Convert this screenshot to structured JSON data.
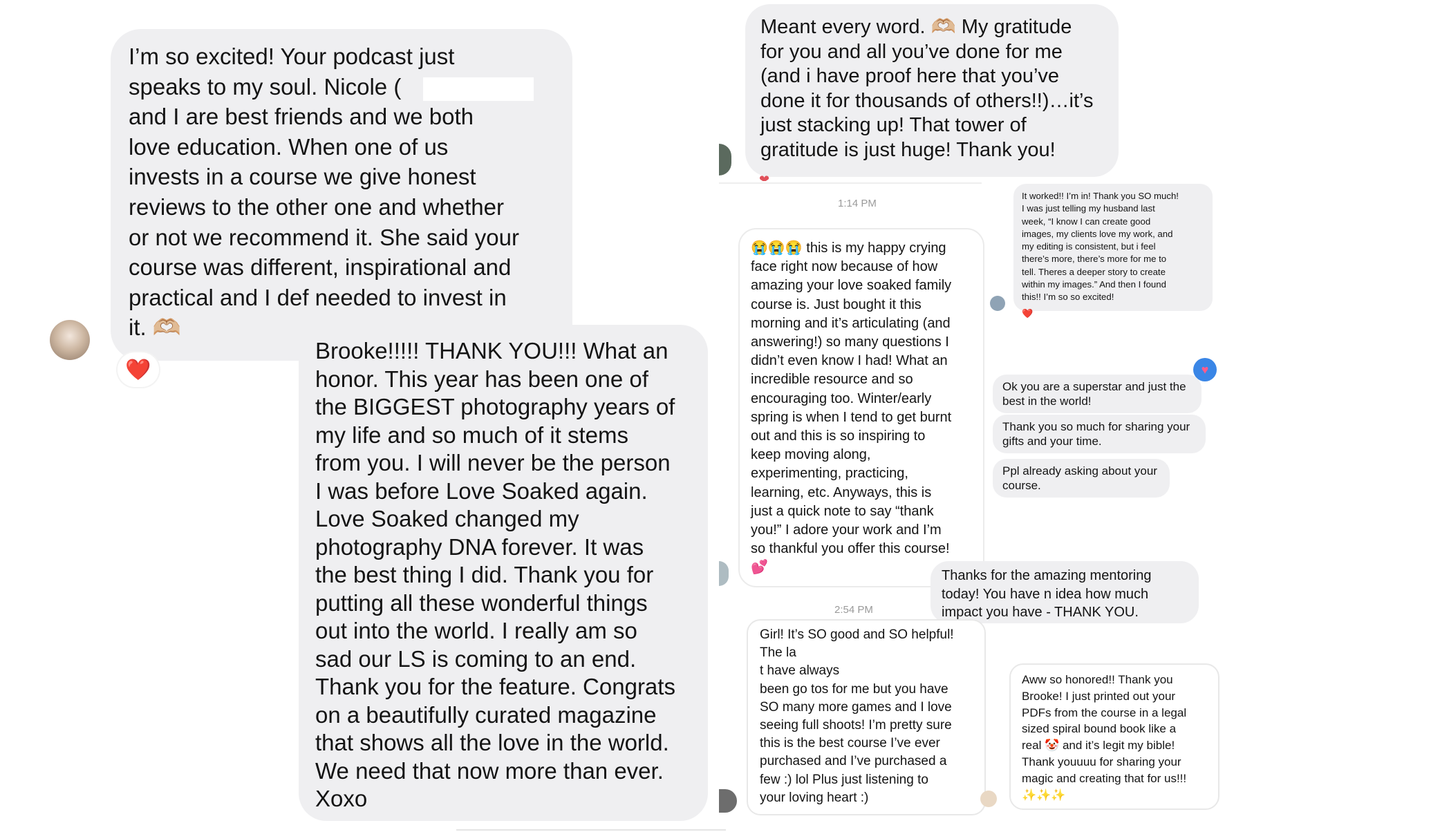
{
  "left": {
    "bubble1": "I’m so excited! Your podcast just\nspeaks to my soul. Nicole (\nand I are best friends and we both\nlove education. When one of us\ninvests in a course we give honest\nreviews to the other one and whether\nor not we recommend it. She said your\ncourse was different, inspirational and\npractical and I def needed to invest in\nit. 🫶🏼",
    "bubble1_reaction": "❤️",
    "bubble2": "Brooke!!!!! THANK YOU!!! What an\nhonor. This year has been one of\nthe BIGGEST photography years of\nmy life and so much of it stems\nfrom you. I will never be the person\nI was before Love Soaked again.\nLove Soaked changed my\nphotography DNA forever. It was\nthe best thing I did. Thank you for\nputting all these wonderful things\nout into the world. I really am so\nsad our LS is coming to an end.\nThank you for the feature. Congrats\non a beautifully curated magazine\nthat shows all the love in the world.\nWe need that now more than ever.\nXoxo"
  },
  "right": {
    "gratitude": "Meant every word. 🫶🏼 My gratitude\nfor you and all you’ve done for me\n(and i have proof here that you’ve\ndone it for thousands of others!!)…it’s\njust stacking up! That tower of\ngratitude is just huge! Thank you!",
    "time1": "1:14 PM",
    "crying": "😭😭😭 this is my happy crying\nface right now because of how\namazing your love soaked family\ncourse is. Just bought it this\nmorning and it’s articulating (and\nanswering!) so many questions I\ndidn’t even know I had! What an\nincredible resource and so\nencouraging too. Winter/early\nspring is when I tend to get burnt\nout and this is so inspiring to\nkeep moving along,\nexperimenting, practicing,\nlearning, etc. Anyways, this is\njust a quick note to say “thank\nyou!” I adore your work and I’m\nso thankful you offer this course!\n💕",
    "it_worked": "It worked!! I’m in! Thank you SO much!\nI was just telling my husband last\nweek, “I know I can create good\nimages, my clients love my work, and\nmy editing is consistent, but i feel\nthere’s more, there’s more for me to\ntell. Theres a deeper story to create\nwithin my images.” And then I found\nthis!! I’m so so excited!",
    "it_worked_reaction": "❤️",
    "superstar": "Ok you are a superstar and just the\nbest in the world!",
    "sharing": "Thank you so much for sharing your\ngifts and your time.",
    "ppl": "Ppl already asking about your\ncourse.",
    "mentoring": "Thanks for the amazing mentoring\ntoday! You have n idea how much\nimpact you have - THANK YOU.",
    "time2": "2:54 PM",
    "girl": "Girl! It’s SO good and SO helpful!\nThe la\nt                  have always\nbeen go tos for me but you have\nSO many more games and I love\nseeing full shoots! I’m pretty sure\nthis is the best course I’ve ever\npurchased and I’ve purchased a\nfew :) lol Plus just listening to\nyour loving heart :)",
    "honored": "Aww so honored!! Thank you\nBrooke! I just printed out your\nPDFs from the course in a legal\nsized spiral bound book like a\nreal 🤡 and it’s legit my bible!\nThank youuuu for sharing your\nmagic and creating that for us!!!\n✨✨✨",
    "accent_color": "#3a86e6"
  }
}
